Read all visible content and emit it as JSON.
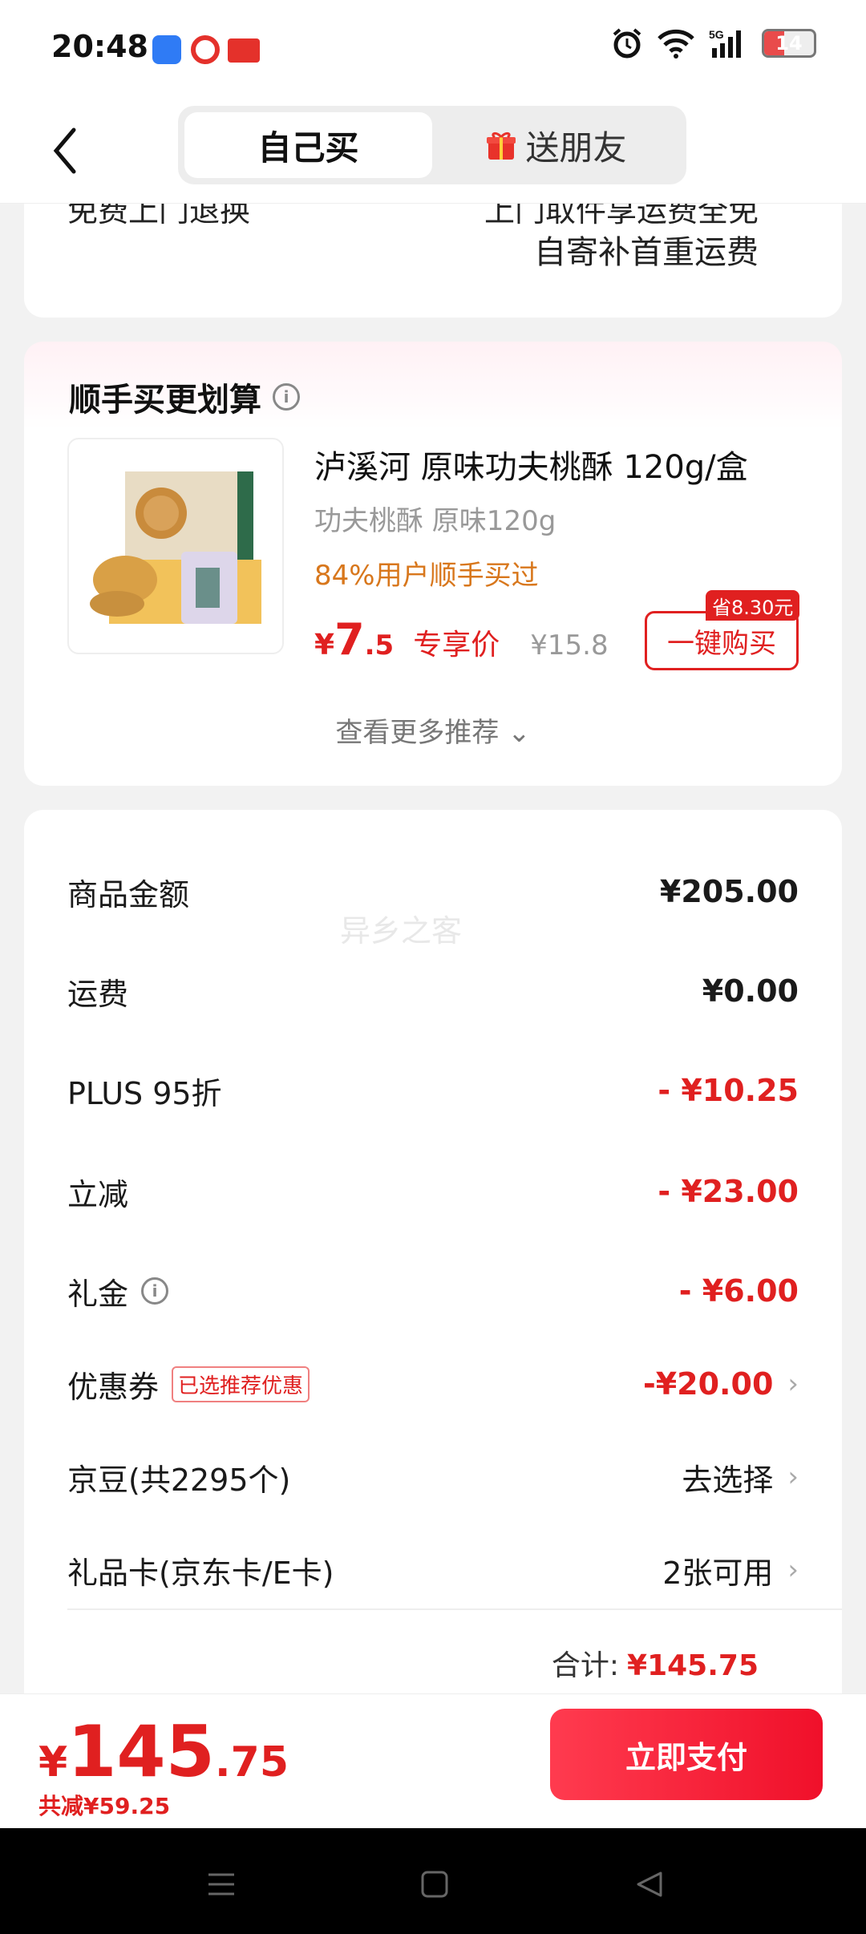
{
  "status_bar": {
    "time": "20:48",
    "battery": "14",
    "network": "5G"
  },
  "header": {
    "tab_self": "自己买",
    "tab_gift": "送朋友"
  },
  "top_card": {
    "cut_left": "免费上门退换",
    "cut_right": "上门取件享运费全免",
    "note": "自寄补首重运费"
  },
  "recommend": {
    "title": "顺手买更划算",
    "product_name": "泸溪河 原味功夫桃酥 120g/盒",
    "spec": "功夫桃酥 原味120g",
    "tag": "84%用户顺手买过",
    "price_yen": "¥",
    "price_int": "7",
    "price_dec": ".5",
    "price_label": "专享价",
    "original_price": "¥15.8",
    "save_badge": "省8.30元",
    "buy_button": "一键购买",
    "more": "查看更多推荐 ⌄"
  },
  "summary": {
    "goods_label": "商品金额",
    "goods_value": "¥205.00",
    "shipping_label": "运费",
    "shipping_value": "¥0.00",
    "plus_label": "PLUS 95折",
    "plus_value": "- ¥10.25",
    "instant_label": "立减",
    "instant_value": "- ¥23.00",
    "gift_label": "礼金",
    "gift_value": "- ¥6.00",
    "coupon_label": "优惠券",
    "coupon_tag": "已选推荐优惠",
    "coupon_value": "-¥20.00",
    "beans_label": "京豆(共2295个)",
    "beans_value": "去选择",
    "giftcard_label": "礼品卡(京东卡/E卡)",
    "giftcard_value": "2张可用",
    "total_label": "合计:",
    "total_value": "¥145.75"
  },
  "watermark": "异乡之客",
  "footer": {
    "yen": "¥",
    "price_int": "145",
    "price_dec": ".75",
    "reduced": "共减¥59.25",
    "pay_button": "立即支付"
  },
  "colors": {
    "accent": "#e02020",
    "tag_orange": "#d8771c"
  }
}
